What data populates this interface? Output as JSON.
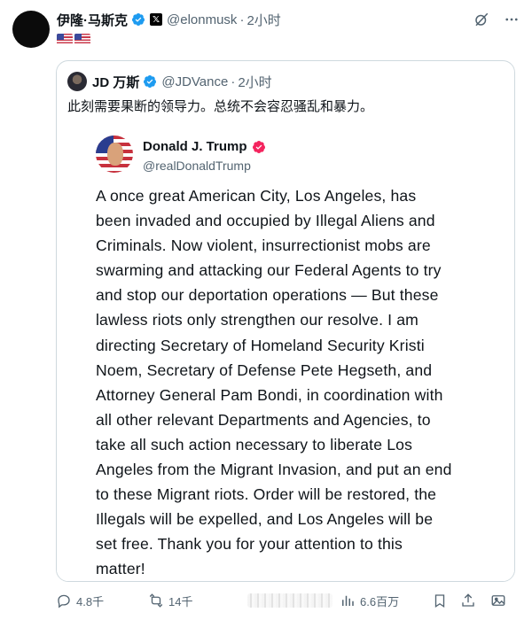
{
  "post": {
    "author_name": "伊隆·马斯克",
    "author_handle": "@elonmusk",
    "time": "2小时",
    "x_badge": "𝕏",
    "flags": [
      "us-flag",
      "us-flag"
    ]
  },
  "quoted": {
    "author_name": "JD 万斯",
    "author_handle": "@JDVance",
    "time": "2小时",
    "text": "此刻需要果断的领导力。总统不会容忍骚乱和暴力。"
  },
  "embedded": {
    "author_name": "Donald J. Trump",
    "author_handle": "@realDonaldTrump",
    "lines": [
      "A once great American City, Los Angeles, has",
      "been invaded and occupied by Illegal Aliens and",
      "Criminals.  Now violent, insurrectionist mobs are",
      "swarming and attacking our Federal Agents to try",
      "and stop our deportation operations — But these",
      "lawless riots only strengthen our resolve. I am",
      "directing Secretary of Homeland Security Kristi",
      "Noem, Secretary of Defense Pete Hegseth, and",
      "Attorney General Pam Bondi, in coordination with",
      "all other relevant Departments and Agencies, to",
      "take all such action necessary to liberate Los",
      "Angeles from the Migrant Invasion, and put an end",
      "to these Migrant riots. Order will be restored, the",
      "Illegals will be expelled, and Los Angeles will be",
      "set free. Thank you for your attention to this",
      "matter!"
    ]
  },
  "actions": {
    "reply_count": "4.8千",
    "retweet_count": "14千",
    "view_count": "6.6百万"
  },
  "colors": {
    "verified_blue": "#1d9bf0",
    "verified_pink": "#f4245e",
    "muted_text": "#536471",
    "border": "#cfd9de"
  },
  "icons": [
    "verified-icon",
    "x-badge-icon",
    "grok-icon",
    "more-icon",
    "reply-icon",
    "retweet-icon",
    "views-icon",
    "bookmark-icon",
    "share-icon",
    "media-icon"
  ]
}
